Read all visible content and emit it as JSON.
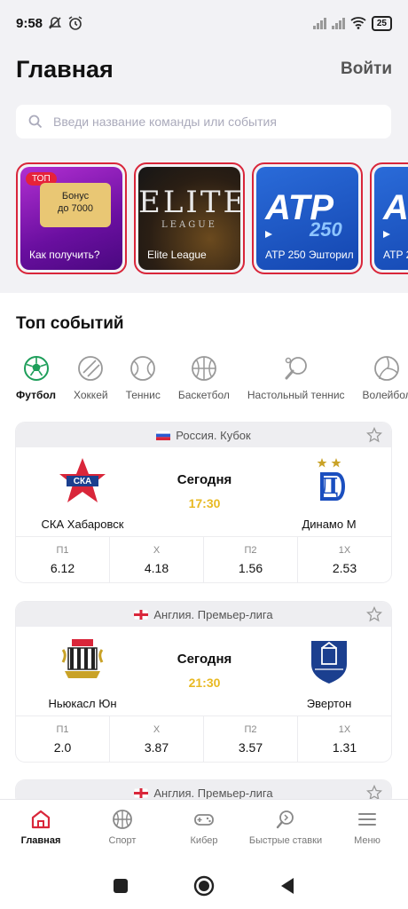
{
  "status": {
    "time": "9:58",
    "battery": "25"
  },
  "header": {
    "title": "Главная",
    "login": "Войти"
  },
  "search": {
    "placeholder": "Введи название команды или события"
  },
  "stories": [
    {
      "badge": "ТОП",
      "bonus_line1": "Бонус",
      "bonus_line2": "до 7000",
      "label": "Как получить?"
    },
    {
      "logo_big": "ELITE",
      "logo_small": "LEAGUE",
      "label": "Elite League"
    },
    {
      "logo": "ATP",
      "logo_sub": "250",
      "label": "ATP 250 Эшторил"
    },
    {
      "logo": "ATP",
      "label": "ATP 2"
    }
  ],
  "section": {
    "title": "Топ событий"
  },
  "sports": [
    {
      "label": "Футбол",
      "icon": "soccer-ball-icon"
    },
    {
      "label": "Хоккей",
      "icon": "hockey-puck-icon"
    },
    {
      "label": "Теннис",
      "icon": "tennis-ball-icon"
    },
    {
      "label": "Баскетбол",
      "icon": "basketball-icon"
    },
    {
      "label": "Настольный теннис",
      "icon": "ping-pong-icon"
    },
    {
      "label": "Волейбол",
      "icon": "volleyball-icon"
    }
  ],
  "events": [
    {
      "league": "Россия. Кубок",
      "flag": "russia-flag-icon",
      "home": "СКА Хабаровск",
      "away": "Динамо М",
      "day": "Сегодня",
      "time": "17:30",
      "odds": [
        {
          "k": "П1",
          "v": "6.12"
        },
        {
          "k": "Х",
          "v": "4.18"
        },
        {
          "k": "П2",
          "v": "1.56"
        },
        {
          "k": "1Х",
          "v": "2.53"
        }
      ]
    },
    {
      "league": "Англия. Премьер-лига",
      "flag": "england-flag-icon",
      "home": "Ньюкасл Юн",
      "away": "Эвертон",
      "day": "Сегодня",
      "time": "21:30",
      "odds": [
        {
          "k": "П1",
          "v": "2.0"
        },
        {
          "k": "Х",
          "v": "3.87"
        },
        {
          "k": "П2",
          "v": "3.57"
        },
        {
          "k": "1Х",
          "v": "1.31"
        }
      ]
    },
    {
      "league": "Англия. Премьер-лига",
      "flag": "england-flag-icon"
    }
  ],
  "nav": [
    {
      "label": "Главная",
      "icon": "home-icon"
    },
    {
      "label": "Спорт",
      "icon": "basketball-icon"
    },
    {
      "label": "Кибер",
      "icon": "gamepad-icon"
    },
    {
      "label": "Быстрые ставки",
      "icon": "quick-bets-icon"
    },
    {
      "label": "Меню",
      "icon": "menu-icon"
    }
  ],
  "colors": {
    "accent": "#d9263a",
    "time": "#e8b923",
    "active_sport": "#1e9e5a"
  }
}
